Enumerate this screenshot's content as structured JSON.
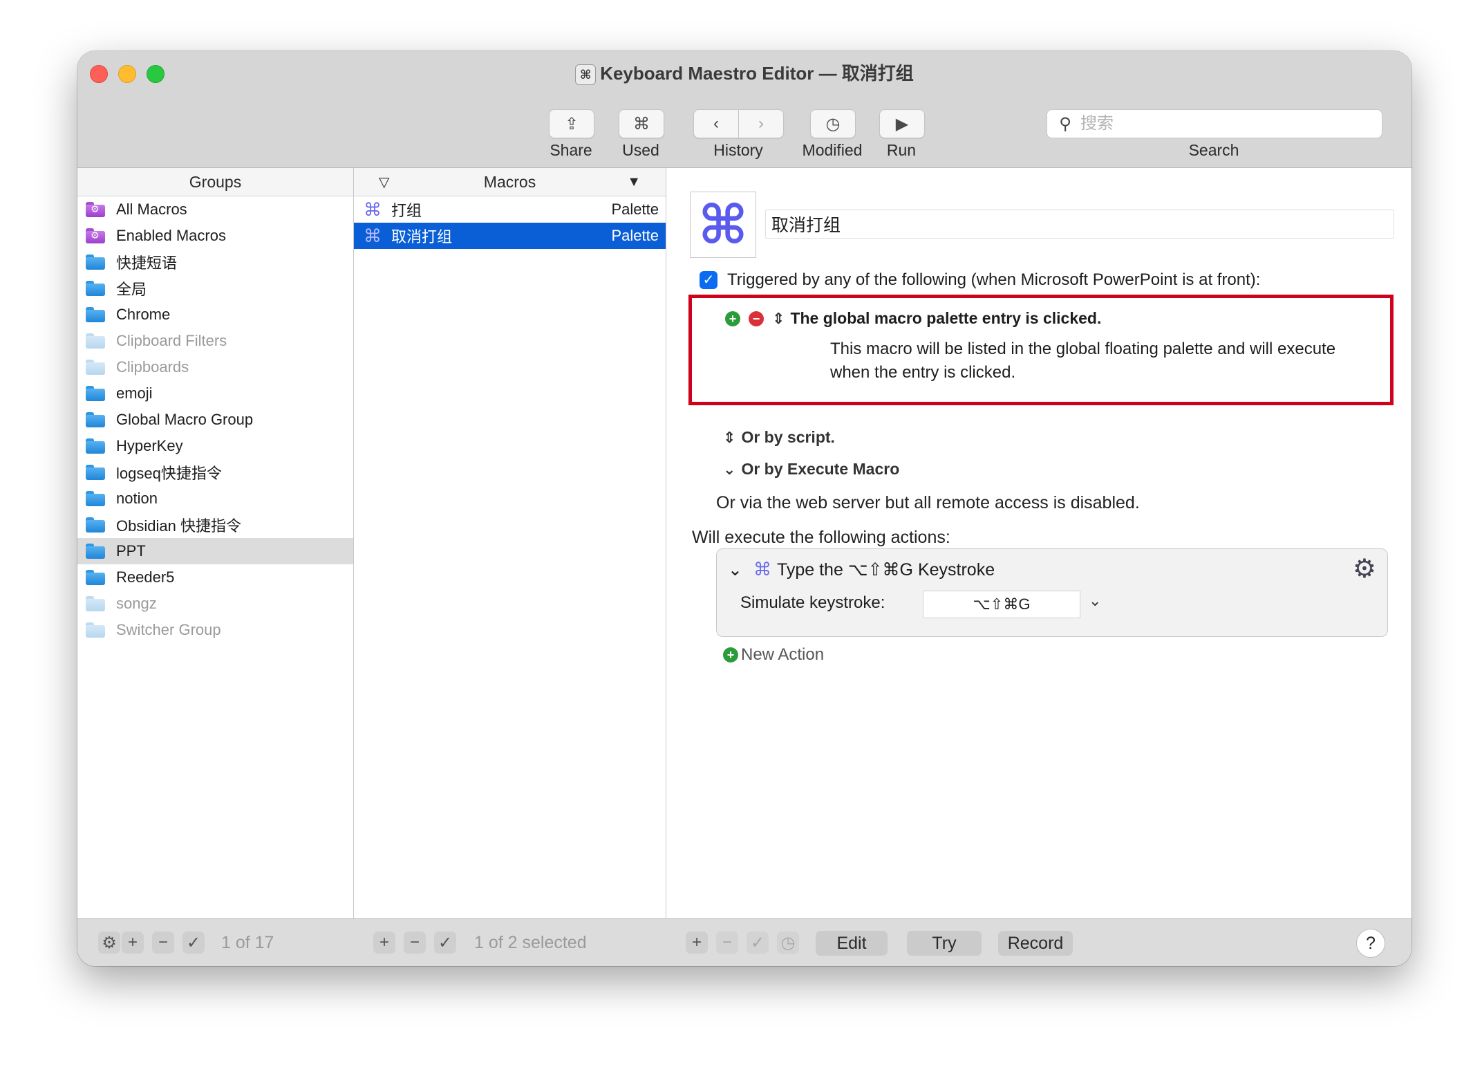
{
  "window": {
    "title": "Keyboard Maestro Editor — 取消打组"
  },
  "toolbar": {
    "share": "Share",
    "used": "Used",
    "history": "History",
    "modified": "Modified",
    "run": "Run",
    "search_label": "Search",
    "search_placeholder": "搜索"
  },
  "groups": {
    "header": "Groups",
    "items": [
      {
        "label": "All Macros"
      },
      {
        "label": "Enabled Macros"
      },
      {
        "label": "快捷短语"
      },
      {
        "label": "全局"
      },
      {
        "label": "Chrome"
      },
      {
        "label": "Clipboard Filters"
      },
      {
        "label": "Clipboards"
      },
      {
        "label": "emoji"
      },
      {
        "label": "Global Macro Group"
      },
      {
        "label": "HyperKey"
      },
      {
        "label": "logseq快捷指令"
      },
      {
        "label": "notion"
      },
      {
        "label": "Obsidian 快捷指令"
      },
      {
        "label": "PPT"
      },
      {
        "label": "Reeder5"
      },
      {
        "label": "songz"
      },
      {
        "label": "Switcher Group"
      }
    ],
    "count": "1 of 17"
  },
  "macros": {
    "header": "Macros",
    "items": [
      {
        "name": "打组",
        "trigger": "Palette"
      },
      {
        "name": "取消打组",
        "trigger": "Palette"
      }
    ],
    "count": "1 of 2 selected"
  },
  "editor": {
    "macro_name": "取消打组",
    "trigger_header": "Triggered by any of the following (when Microsoft PowerPoint is at front):",
    "trigger_title": "The global macro palette entry is clicked.",
    "trigger_desc": "This macro will be listed in the global floating palette and will execute when the entry is clicked.",
    "or_script": "Or by script.",
    "or_execute": "Or by Execute Macro",
    "web_server": "Or via the web server but all remote access is disabled.",
    "actions_header": "Will execute the following actions:",
    "action_title": "Type the ⌥⇧⌘G Keystroke",
    "simulate_label": "Simulate keystroke:",
    "simulate_value": "⌥⇧⌘G",
    "new_action": "New Action"
  },
  "bottom": {
    "edit": "Edit",
    "try": "Try",
    "record": "Record",
    "help": "?"
  }
}
